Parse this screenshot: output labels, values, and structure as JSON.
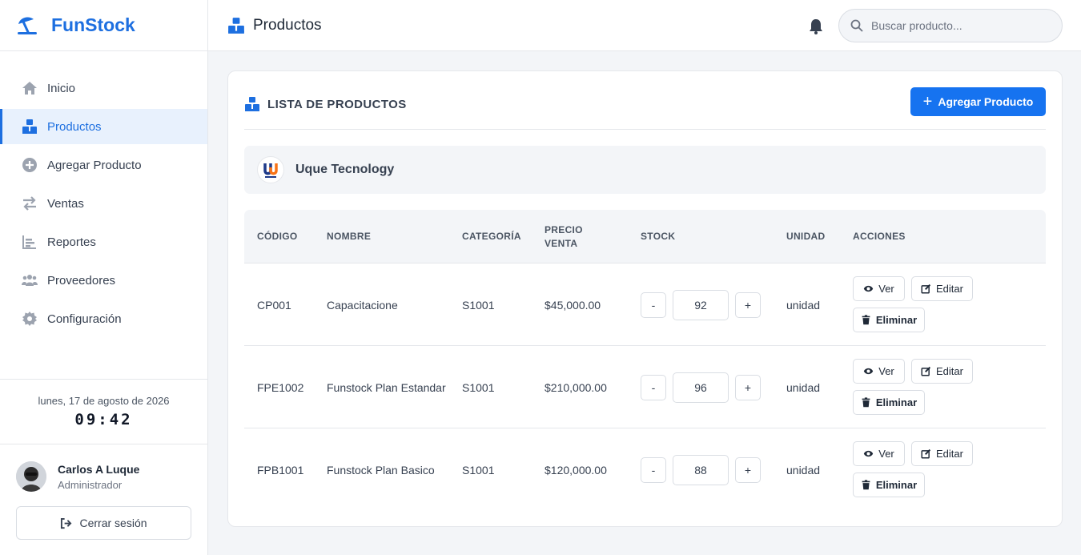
{
  "brand": {
    "name": "FunStock",
    "icon": "umbrella-beach-icon",
    "color": "#1d6fe0"
  },
  "sidebar": {
    "items": [
      {
        "label": "Inicio",
        "icon": "home-icon",
        "active": false
      },
      {
        "label": "Productos",
        "icon": "boxes-icon",
        "active": true
      },
      {
        "label": "Agregar Producto",
        "icon": "plus-circle-icon",
        "active": false
      },
      {
        "label": "Ventas",
        "icon": "exchange-icon",
        "active": false
      },
      {
        "label": "Reportes",
        "icon": "chart-bar-icon",
        "active": false
      },
      {
        "label": "Proveedores",
        "icon": "users-icon",
        "active": false
      },
      {
        "label": "Configuración",
        "icon": "gear-icon",
        "active": false
      }
    ],
    "date": "lunes, 17 de agosto de 2026",
    "time": "09:42",
    "user": {
      "name": "Carlos A Luque",
      "role": "Administrador"
    },
    "logout_label": "Cerrar sesión"
  },
  "header": {
    "title": "Productos",
    "search_placeholder": "Buscar producto..."
  },
  "card": {
    "title": "LISTA DE PRODUCTOS",
    "add_button": "Agregar Producto",
    "company": "Uque Tecnology"
  },
  "table": {
    "headers": {
      "code": "CÓDIGO",
      "name": "NOMBRE",
      "category": "CATEGORÍA",
      "price": "PRECIO VENTA",
      "stock": "STOCK",
      "unit": "UNIDAD",
      "actions": "ACCIONES"
    },
    "rows": [
      {
        "code": "CP001",
        "name": "Capacitacione",
        "category": "S1001",
        "price": "$45,000.00",
        "stock": "92",
        "unit": "unidad"
      },
      {
        "code": "FPE1002",
        "name": "Funstock Plan Estandar",
        "category": "S1001",
        "price": "$210,000.00",
        "stock": "96",
        "unit": "unidad"
      },
      {
        "code": "FPB1001",
        "name": "Funstock Plan Basico",
        "category": "S1001",
        "price": "$120,000.00",
        "stock": "88",
        "unit": "unidad"
      }
    ],
    "step_minus": "-",
    "step_plus": "+",
    "btn_view": "Ver",
    "btn_edit": "Editar",
    "btn_delete": "Eliminar"
  },
  "colors": {
    "primary": "#1673f0",
    "active_bg": "#e8f1fd",
    "page_bg": "#f3f5f8"
  }
}
